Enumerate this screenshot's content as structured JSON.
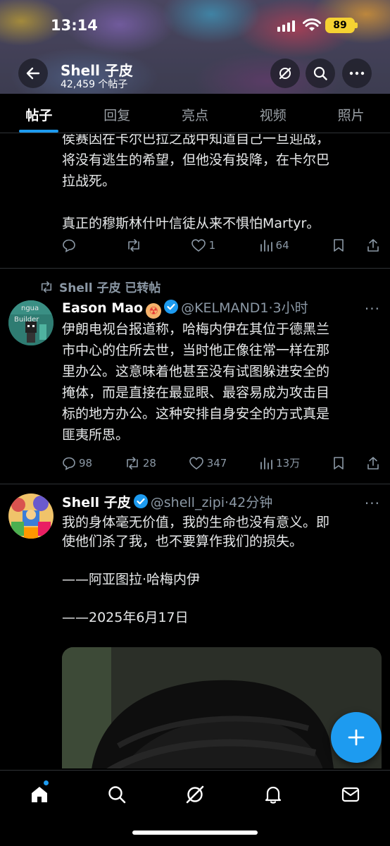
{
  "status_bar": {
    "time": "13:14",
    "battery": "89"
  },
  "header": {
    "profile_name": "Shell 子皮",
    "post_count": "42,459 个帖子"
  },
  "tabs": [
    {
      "label": "帖子",
      "active": true
    },
    {
      "label": "回复"
    },
    {
      "label": "亮点"
    },
    {
      "label": "视频"
    },
    {
      "label": "照片"
    }
  ],
  "posts": [
    {
      "text": "侯赛因在卡尔巴拉之战中知道自己一旦迎战，\n将没有逃生的希望，但他没有投降，在卡尔巴\n拉战死。\n\n真正的穆斯林什叶信徒从来不惧怕Martyr。",
      "replies": "",
      "reposts": "",
      "likes": "1",
      "views": "64"
    },
    {
      "repost_label": "Shell 子皮 已转帖",
      "author_name": "Eason Mao",
      "author_emoji": "☢",
      "handle": "@KELMAND1",
      "time": "3小时",
      "text": "伊朗电视台报道称，哈梅内伊在其位于德黑兰\n市中心的住所去世，当时他正像往常一样在那\n里办公。这意味着他甚至没有试图躲进安全的\n掩体，而是直接在最显眼、最容易成为攻击目\n标的地方办公。这种安排自身安全的方式真是\n匪夷所思。",
      "replies": "98",
      "reposts": "28",
      "likes": "347",
      "views": "13万"
    },
    {
      "author_name": "Shell 子皮",
      "handle": "@shell_zipi",
      "time": "42分钟",
      "text": "我的身体毫无价值，我的生命也没有意义。即\n使他们杀了我，也不要算作我们的损失。\n\n——阿亚图拉·哈梅内伊\n\n——2025年6月17日"
    }
  ],
  "colors": {
    "accent": "#1d9bf0",
    "background": "#000000",
    "muted": "#8b98a5"
  },
  "icons": [
    "back-arrow-icon",
    "grok-icon",
    "search-icon",
    "more-icon",
    "reply-icon",
    "repost-icon",
    "like-icon",
    "views-icon",
    "bookmark-icon",
    "share-icon",
    "verified-icon",
    "compose-plus-icon",
    "home-icon",
    "notifications-icon",
    "messages-icon"
  ]
}
